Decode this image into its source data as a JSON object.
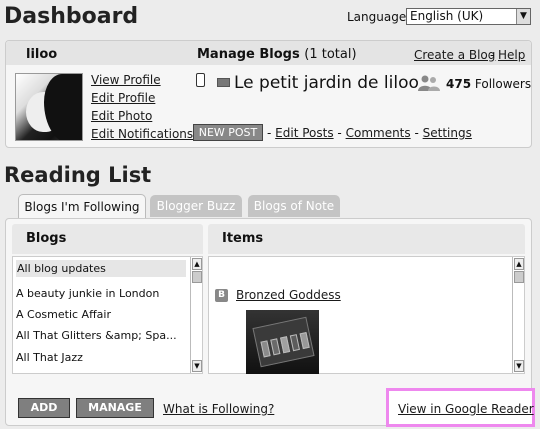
{
  "header": {
    "title": "Dashboard",
    "language_label": "Language:",
    "language_value": "English (UK)"
  },
  "profile": {
    "username": "liloo",
    "manage_blogs_label": "Manage Blogs",
    "manage_blogs_count": "(1 total)",
    "create_blog": "Create a Blog",
    "separator": "-",
    "help": "Help",
    "links": [
      "View Profile",
      "Edit Profile",
      "Edit Photo",
      "Edit Notifications"
    ]
  },
  "blog": {
    "title": "Le petit jardin de liloo",
    "followers_count": "475",
    "followers_label": "Followers",
    "new_post": "NEW POST",
    "edit_posts": "Edit Posts",
    "comments": "Comments",
    "settings": "Settings",
    "dash": "-"
  },
  "reading_list": {
    "title": "Reading List",
    "tabs": [
      {
        "label": "Blogs I'm Following",
        "active": true
      },
      {
        "label": "Blogger Buzz",
        "active": false
      },
      {
        "label": "Blogs of Note",
        "active": false
      }
    ],
    "blogs_header": "Blogs",
    "items_header": "Items",
    "blogs": [
      "All blog updates",
      "A beauty junkie in London",
      "A Cosmetic Affair",
      "All That Glitters &amp; Spa...",
      "All That Jazz"
    ],
    "item_title": "Bronzed Goddess",
    "add_button": "ADD",
    "manage_button": "MANAGE",
    "what_is_following": "What is Following?",
    "view_google_reader": "View in Google Reader"
  },
  "colors": {
    "highlight": "#ee88ee",
    "button_grey": "#7f7f7f"
  },
  "icons": [
    "phone-icon",
    "mail-icon",
    "followers-icon",
    "blogger-icon",
    "dropdown-arrow-icon",
    "scroll-up-icon",
    "scroll-down-icon"
  ]
}
